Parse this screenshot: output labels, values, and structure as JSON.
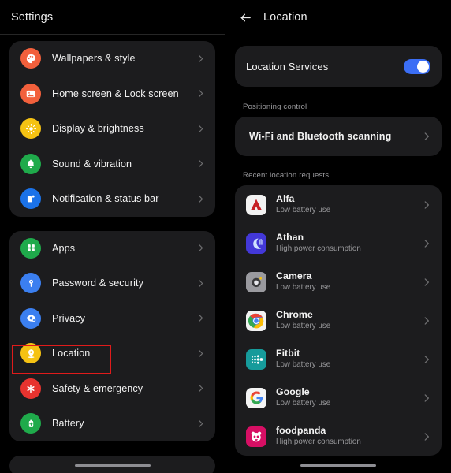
{
  "left_panel": {
    "header": {
      "title": "Settings"
    },
    "groups": [
      {
        "name": "personalization-group",
        "items": [
          {
            "label": "Wallpapers & style",
            "icon": "palette-icon",
            "color": "#f2603c"
          },
          {
            "label": "Home screen & Lock screen",
            "icon": "image-icon",
            "color": "#f2603c"
          },
          {
            "label": "Display & brightness",
            "icon": "brightness-icon",
            "color": "#f5c213"
          },
          {
            "label": "Sound & vibration",
            "icon": "bell-icon",
            "color": "#1faa4b"
          },
          {
            "label": "Notification & status bar",
            "icon": "notification-icon",
            "color": "#1b72e8"
          }
        ]
      },
      {
        "name": "system-group",
        "items": [
          {
            "label": "Apps",
            "icon": "grid-icon",
            "color": "#1faa4b"
          },
          {
            "label": "Password & security",
            "icon": "key-icon",
            "color": "#3b7ff0"
          },
          {
            "label": "Privacy",
            "icon": "privacy-icon",
            "color": "#3b7ff0"
          },
          {
            "label": "Location",
            "icon": "location-icon",
            "color": "#f5c213"
          },
          {
            "label": "Safety & emergency",
            "icon": "asterisk-icon",
            "color": "#e8332f"
          },
          {
            "label": "Battery",
            "icon": "battery-icon",
            "color": "#1faa4b"
          }
        ]
      }
    ]
  },
  "right_panel": {
    "header": {
      "title": "Location",
      "back_icon": "back-arrow-icon"
    },
    "location_services": {
      "label": "Location Services",
      "enabled": true
    },
    "positioning_control": {
      "section_label": "Positioning control",
      "item_label": "Wi-Fi and Bluetooth scanning"
    },
    "recent_requests": {
      "section_label": "Recent location requests",
      "apps": [
        {
          "name": "Alfa",
          "status": "Low battery use",
          "icon": "alfa-icon"
        },
        {
          "name": "Athan",
          "status": "High power consumption",
          "icon": "athan-icon"
        },
        {
          "name": "Camera",
          "status": "Low battery use",
          "icon": "camera-icon"
        },
        {
          "name": "Chrome",
          "status": "Low battery use",
          "icon": "chrome-icon"
        },
        {
          "name": "Fitbit",
          "status": "Low battery use",
          "icon": "fitbit-icon"
        },
        {
          "name": "Google",
          "status": "Low battery use",
          "icon": "google-icon"
        },
        {
          "name": "foodpanda",
          "status": "High power consumption",
          "icon": "foodpanda-icon"
        }
      ]
    }
  },
  "annotations": {
    "highlight_color": "#e01b1b",
    "boxes": [
      {
        "target": "sidebar-item-location"
      },
      {
        "target": "location-services-row"
      }
    ]
  },
  "theme": {
    "background": "#000000",
    "card_background": "#1c1c1e",
    "accent_blue": "#3b6ef5",
    "text_primary": "#f2f2f2",
    "text_secondary": "#9a9a9d"
  }
}
